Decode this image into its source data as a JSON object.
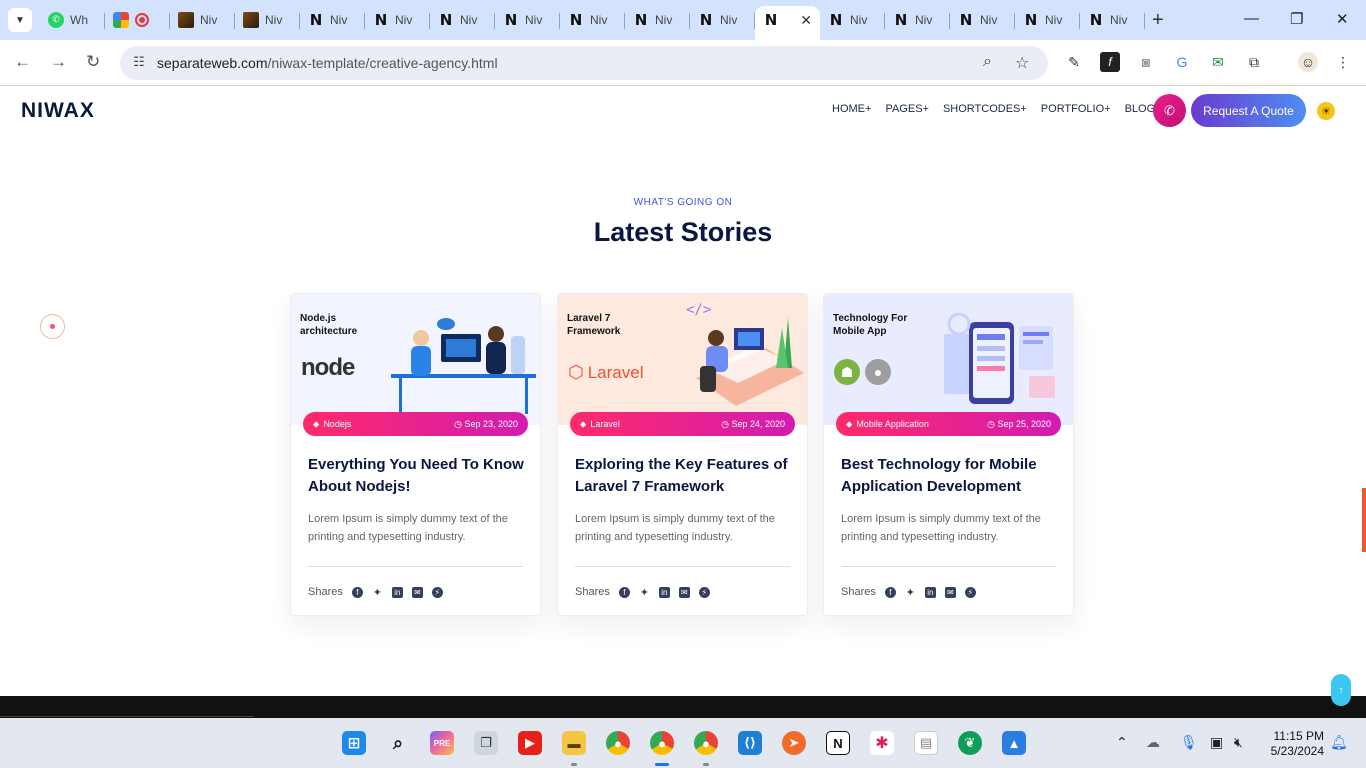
{
  "browser": {
    "tabs": [
      {
        "icon": "whatsapp-icon",
        "label": "Wh",
        "active": false
      },
      {
        "icon": "google-maps-icon",
        "label": "",
        "active": false
      },
      {
        "icon": "record-icon",
        "label": "",
        "active": false
      },
      {
        "icon": "template-thumb-icon",
        "label": "Niv",
        "active": false
      },
      {
        "icon": "template-thumb-icon",
        "label": "Niv",
        "active": false
      },
      {
        "icon": "niwax-n-icon",
        "label": "Niv",
        "active": false
      },
      {
        "icon": "niwax-n-icon",
        "label": "Niv",
        "active": false
      },
      {
        "icon": "niwax-n-icon",
        "label": "Niv",
        "active": false
      },
      {
        "icon": "niwax-n-icon",
        "label": "Niv",
        "active": false
      },
      {
        "icon": "niwax-n-icon",
        "label": "Niv",
        "active": false
      },
      {
        "icon": "niwax-n-icon",
        "label": "Niv",
        "active": false
      },
      {
        "icon": "niwax-n-icon",
        "label": "Niv",
        "active": false
      },
      {
        "icon": "niwax-n-icon",
        "label": "",
        "active": true
      },
      {
        "icon": "niwax-n-icon",
        "label": "Niv",
        "active": false
      },
      {
        "icon": "niwax-n-icon",
        "label": "Niv",
        "active": false
      },
      {
        "icon": "niwax-n-icon",
        "label": "Niv",
        "active": false
      },
      {
        "icon": "niwax-n-icon",
        "label": "Niv",
        "active": false
      },
      {
        "icon": "niwax-n-icon",
        "label": "Niv",
        "active": false
      }
    ],
    "url_domain": "separateweb.com",
    "url_path": "/niwax-template/creative-agency.html"
  },
  "site": {
    "logo": "NIWAX",
    "menu": [
      "HOME+",
      "PAGES+",
      "SHORTCODES+",
      "PORTFOLIO+",
      "BLOG+"
    ],
    "quote_button": "Request A Quote",
    "eyebrow": "WHAT'S GOING ON",
    "heading": "Latest Stories",
    "accent_colors": {
      "pink": "#e81e8c",
      "purple": "#6a3bd1",
      "blue": "#4d8ff0",
      "navy": "#0a1740"
    },
    "cards": [
      {
        "image_title": "Node.js architecture",
        "image_logo": "node",
        "category": "Nodejs",
        "date": "Sep 23, 2020",
        "title": "Everything You Need To Know About Nodejs!",
        "excerpt": "Lorem Ipsum is simply dummy text of the printing and typesetting industry.",
        "shares_label": "Shares"
      },
      {
        "image_title": "Laravel 7 Framework",
        "image_logo": "Laravel",
        "category": "Laravel",
        "date": "Sep 24, 2020",
        "title": "Exploring the Key Features of Laravel 7 Framework",
        "excerpt": "Lorem Ipsum is simply dummy text of the printing and typesetting industry.",
        "shares_label": "Shares"
      },
      {
        "image_title": "Technology For Mobile App",
        "image_logo": "",
        "category": "Mobile Application",
        "date": "Sep 25, 2020",
        "title": "Best Technology for Mobile Application Development",
        "excerpt": "Lorem Ipsum is simply dummy text of the printing and typesetting industry.",
        "shares_label": "Shares"
      }
    ]
  },
  "taskbar": {
    "time": "11:15 PM",
    "date": "5/23/2024"
  }
}
